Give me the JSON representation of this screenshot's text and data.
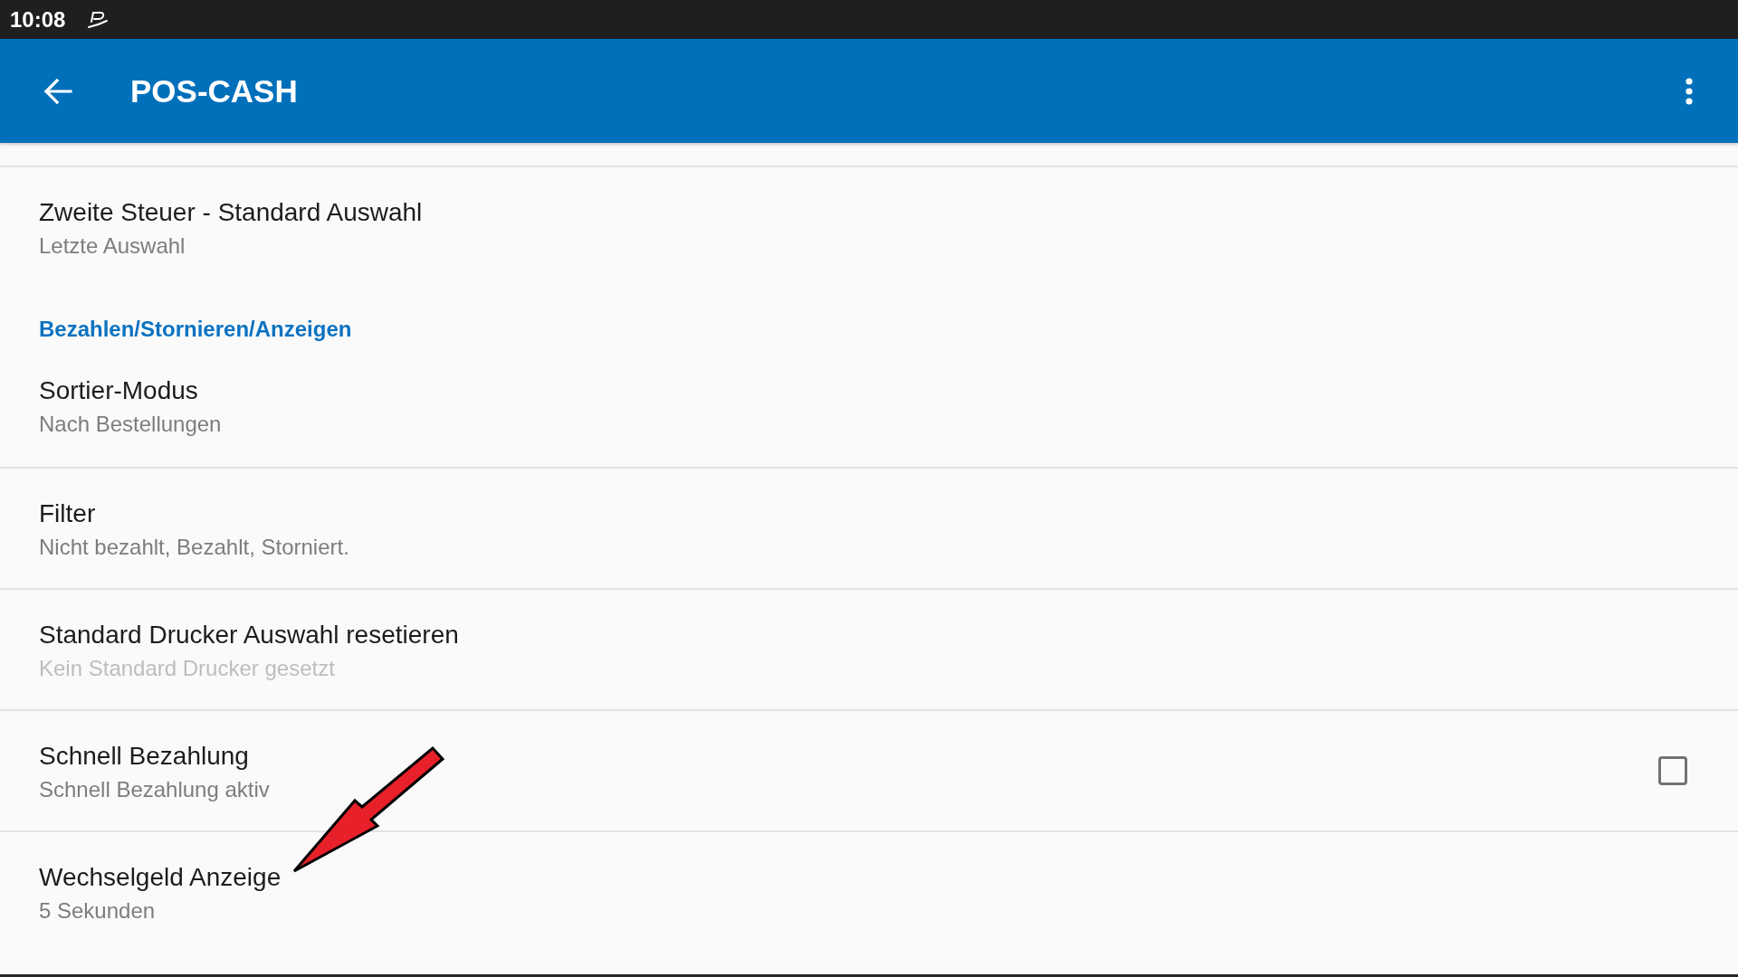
{
  "status_bar": {
    "time": "10:08"
  },
  "app_bar": {
    "title": "POS-CASH"
  },
  "preferences": [
    {
      "kind": "item",
      "title": "Zweite Steuer - Standard Auswahl",
      "summary": "Letzte Auswahl",
      "summary_disabled": false
    },
    {
      "kind": "category",
      "title": "Bezahlen/Stornieren/Anzeigen"
    },
    {
      "kind": "item",
      "title": "Sortier-Modus",
      "summary": "Nach Bestellungen",
      "summary_disabled": false
    },
    {
      "kind": "item",
      "title": "Filter",
      "summary": "Nicht bezahlt, Bezahlt, Storniert.",
      "summary_disabled": false
    },
    {
      "kind": "item",
      "title": "Standard Drucker Auswahl resetieren",
      "summary": "Kein Standard Drucker gesetzt",
      "summary_disabled": true
    },
    {
      "kind": "checkbox",
      "title": "Schnell Bezahlung",
      "summary": "Schnell Bezahlung aktiv",
      "summary_disabled": false,
      "checked": false
    },
    {
      "kind": "item",
      "title": "Wechselgeld Anzeige",
      "summary": "5 Sekunden",
      "summary_disabled": false
    }
  ]
}
